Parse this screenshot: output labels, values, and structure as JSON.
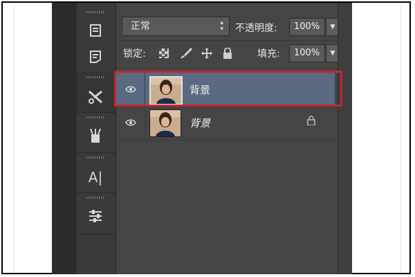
{
  "blend_mode": {
    "selected": "正常"
  },
  "opacity": {
    "label": "不透明度:",
    "value": "100%"
  },
  "lock": {
    "label": "锁定:"
  },
  "fill": {
    "label": "填充:",
    "value": "100%"
  },
  "layers": [
    {
      "name": "背景",
      "selected": true,
      "visible": true,
      "locked": false,
      "italic": false
    },
    {
      "name": "背景",
      "selected": false,
      "visible": true,
      "locked": true,
      "italic": true
    }
  ],
  "icons": {
    "toolbar": [
      "history-icon",
      "properties-icon",
      "tools-icon",
      "brush-presets-icon",
      "character-icon",
      "adjustments-icon"
    ],
    "lock": [
      "lock-transparent-pixels-icon",
      "lock-image-pixels-icon",
      "lock-position-icon",
      "lock-all-icon"
    ]
  },
  "colors": {
    "selected_row": "#5a6a82",
    "highlight": "#c8252d",
    "panel_bg": "#454545"
  }
}
